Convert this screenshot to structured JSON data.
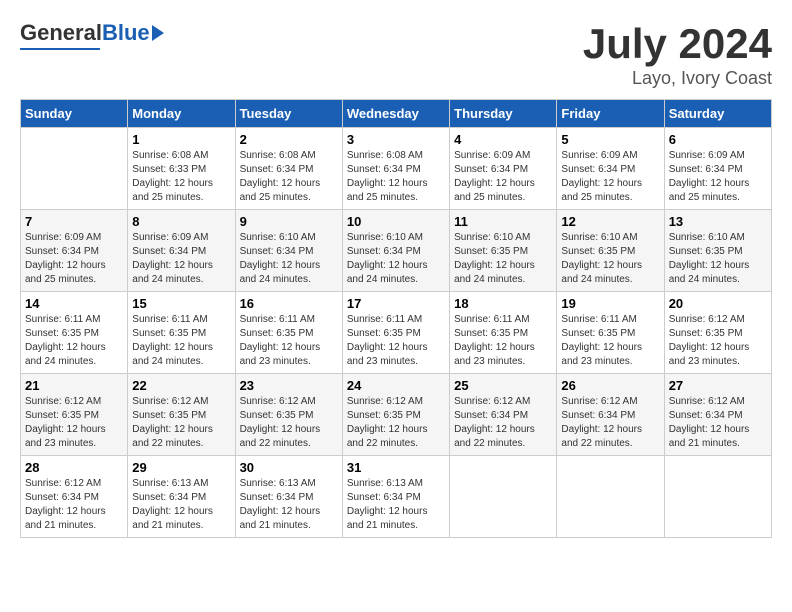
{
  "header": {
    "logo_general": "General",
    "logo_blue": "Blue",
    "title": "July 2024",
    "subtitle": "Layo, Ivory Coast"
  },
  "calendar": {
    "days_of_week": [
      "Sunday",
      "Monday",
      "Tuesday",
      "Wednesday",
      "Thursday",
      "Friday",
      "Saturday"
    ],
    "weeks": [
      [
        {
          "day": "",
          "info": ""
        },
        {
          "day": "1",
          "info": "Sunrise: 6:08 AM\nSunset: 6:33 PM\nDaylight: 12 hours\nand 25 minutes."
        },
        {
          "day": "2",
          "info": "Sunrise: 6:08 AM\nSunset: 6:34 PM\nDaylight: 12 hours\nand 25 minutes."
        },
        {
          "day": "3",
          "info": "Sunrise: 6:08 AM\nSunset: 6:34 PM\nDaylight: 12 hours\nand 25 minutes."
        },
        {
          "day": "4",
          "info": "Sunrise: 6:09 AM\nSunset: 6:34 PM\nDaylight: 12 hours\nand 25 minutes."
        },
        {
          "day": "5",
          "info": "Sunrise: 6:09 AM\nSunset: 6:34 PM\nDaylight: 12 hours\nand 25 minutes."
        },
        {
          "day": "6",
          "info": "Sunrise: 6:09 AM\nSunset: 6:34 PM\nDaylight: 12 hours\nand 25 minutes."
        }
      ],
      [
        {
          "day": "7",
          "info": "Sunrise: 6:09 AM\nSunset: 6:34 PM\nDaylight: 12 hours\nand 25 minutes."
        },
        {
          "day": "8",
          "info": "Sunrise: 6:09 AM\nSunset: 6:34 PM\nDaylight: 12 hours\nand 24 minutes."
        },
        {
          "day": "9",
          "info": "Sunrise: 6:10 AM\nSunset: 6:34 PM\nDaylight: 12 hours\nand 24 minutes."
        },
        {
          "day": "10",
          "info": "Sunrise: 6:10 AM\nSunset: 6:34 PM\nDaylight: 12 hours\nand 24 minutes."
        },
        {
          "day": "11",
          "info": "Sunrise: 6:10 AM\nSunset: 6:35 PM\nDaylight: 12 hours\nand 24 minutes."
        },
        {
          "day": "12",
          "info": "Sunrise: 6:10 AM\nSunset: 6:35 PM\nDaylight: 12 hours\nand 24 minutes."
        },
        {
          "day": "13",
          "info": "Sunrise: 6:10 AM\nSunset: 6:35 PM\nDaylight: 12 hours\nand 24 minutes."
        }
      ],
      [
        {
          "day": "14",
          "info": "Sunrise: 6:11 AM\nSunset: 6:35 PM\nDaylight: 12 hours\nand 24 minutes."
        },
        {
          "day": "15",
          "info": "Sunrise: 6:11 AM\nSunset: 6:35 PM\nDaylight: 12 hours\nand 24 minutes."
        },
        {
          "day": "16",
          "info": "Sunrise: 6:11 AM\nSunset: 6:35 PM\nDaylight: 12 hours\nand 23 minutes."
        },
        {
          "day": "17",
          "info": "Sunrise: 6:11 AM\nSunset: 6:35 PM\nDaylight: 12 hours\nand 23 minutes."
        },
        {
          "day": "18",
          "info": "Sunrise: 6:11 AM\nSunset: 6:35 PM\nDaylight: 12 hours\nand 23 minutes."
        },
        {
          "day": "19",
          "info": "Sunrise: 6:11 AM\nSunset: 6:35 PM\nDaylight: 12 hours\nand 23 minutes."
        },
        {
          "day": "20",
          "info": "Sunrise: 6:12 AM\nSunset: 6:35 PM\nDaylight: 12 hours\nand 23 minutes."
        }
      ],
      [
        {
          "day": "21",
          "info": "Sunrise: 6:12 AM\nSunset: 6:35 PM\nDaylight: 12 hours\nand 23 minutes."
        },
        {
          "day": "22",
          "info": "Sunrise: 6:12 AM\nSunset: 6:35 PM\nDaylight: 12 hours\nand 22 minutes."
        },
        {
          "day": "23",
          "info": "Sunrise: 6:12 AM\nSunset: 6:35 PM\nDaylight: 12 hours\nand 22 minutes."
        },
        {
          "day": "24",
          "info": "Sunrise: 6:12 AM\nSunset: 6:35 PM\nDaylight: 12 hours\nand 22 minutes."
        },
        {
          "day": "25",
          "info": "Sunrise: 6:12 AM\nSunset: 6:34 PM\nDaylight: 12 hours\nand 22 minutes."
        },
        {
          "day": "26",
          "info": "Sunrise: 6:12 AM\nSunset: 6:34 PM\nDaylight: 12 hours\nand 22 minutes."
        },
        {
          "day": "27",
          "info": "Sunrise: 6:12 AM\nSunset: 6:34 PM\nDaylight: 12 hours\nand 21 minutes."
        }
      ],
      [
        {
          "day": "28",
          "info": "Sunrise: 6:12 AM\nSunset: 6:34 PM\nDaylight: 12 hours\nand 21 minutes."
        },
        {
          "day": "29",
          "info": "Sunrise: 6:13 AM\nSunset: 6:34 PM\nDaylight: 12 hours\nand 21 minutes."
        },
        {
          "day": "30",
          "info": "Sunrise: 6:13 AM\nSunset: 6:34 PM\nDaylight: 12 hours\nand 21 minutes."
        },
        {
          "day": "31",
          "info": "Sunrise: 6:13 AM\nSunset: 6:34 PM\nDaylight: 12 hours\nand 21 minutes."
        },
        {
          "day": "",
          "info": ""
        },
        {
          "day": "",
          "info": ""
        },
        {
          "day": "",
          "info": ""
        }
      ]
    ]
  }
}
